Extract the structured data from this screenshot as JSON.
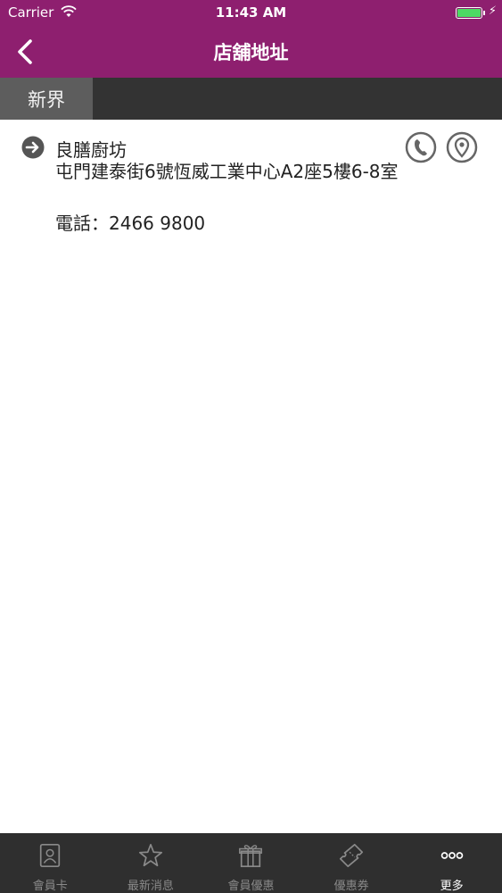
{
  "status": {
    "carrier": "Carrier",
    "time": "11:43 AM",
    "battery_level": 1.0
  },
  "header": {
    "title": "店舖地址"
  },
  "region": {
    "selected": "新界"
  },
  "stores": [
    {
      "name": "良膳廚坊",
      "address": "屯門建泰街6號恆威工業中心A2座5樓6-8室",
      "phone": "電話：2466 9800"
    }
  ],
  "tabs": [
    {
      "label": "會員卡",
      "icon": "member-card-icon"
    },
    {
      "label": "最新消息",
      "icon": "star-icon"
    },
    {
      "label": "會員優惠",
      "icon": "gift-icon"
    },
    {
      "label": "優惠券",
      "icon": "coupon-icon"
    },
    {
      "label": "更多",
      "icon": "more-icon",
      "active": true
    }
  ],
  "colors": {
    "brand": "#8e1f6f",
    "region_bar": "#333333",
    "region_tab": "#5d5d5d",
    "tab_bar": "#2f2f2f",
    "icon_gray": "#666666"
  }
}
